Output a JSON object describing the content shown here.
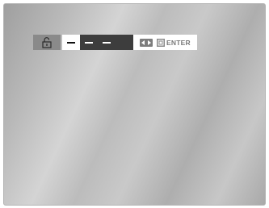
{
  "osd": {
    "lock_icon": "lock-icon",
    "digit_slots": [
      "–",
      "–",
      "–",
      "–"
    ],
    "active_slot": 0,
    "help": {
      "navigate_icon": "left-right-arrows-icon",
      "enter_icon": "enter-icon",
      "enter_label": "ENTER"
    }
  },
  "colors": {
    "lock_box": "#8a8a8a",
    "digits_bg": "#3d3d3d",
    "active_slot_bg": "#ffffff",
    "help_bg": "#ffffff",
    "help_text": "#7a7a7a"
  }
}
